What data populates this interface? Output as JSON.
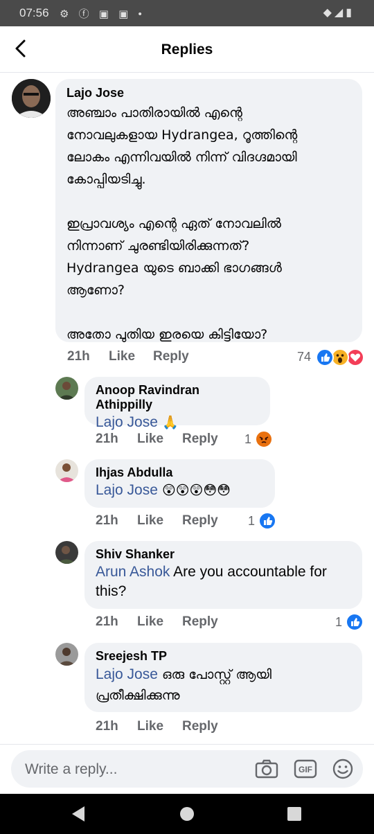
{
  "status_bar": {
    "time": "07:56",
    "left_icons": "⚙ ⓕ ▣ ▣ •",
    "right_icons": "◆◢▮"
  },
  "header": {
    "title": "Replies"
  },
  "main_comment": {
    "author": "Lajo Jose",
    "lines": [
      "അഞ്ചാം പാതിരായിൽ എന്റെ",
      "നോവലുകളായ Hydrangea, റൂത്തിന്റെ",
      "ലോകം എന്നിവയിൽ നിന്ന് വിദഗ്ദമായി",
      "കോപ്പിയടിച്ചു.",
      "",
      "ഇപ്രാവശ്യം എന്റെ ഏത് നോവലിൽ",
      "നിന്നാണ് ചുരണ്ടിയിരിക്കുന്നത്?",
      "Hydrangea യുടെ ബാക്കി ഭാഗങ്ങൾ",
      "ആണോ?",
      "",
      "അതോ പുതിയ ഇരയെ കിട്ടിയോ?"
    ],
    "time": "21h",
    "like": "Like",
    "reply": "Reply",
    "reaction_count": "74"
  },
  "replies": [
    {
      "author": "Anoop Ravindran Athippilly",
      "mention": "Lajo Jose",
      "text": " 🙏",
      "time": "21h",
      "like": "Like",
      "reply": "Reply",
      "reaction_count": "1"
    },
    {
      "author": "Ihjas Abdulla",
      "mention": "Lajo Jose",
      "text": " 😲😲😲😳😳",
      "time": "21h",
      "like": "Like",
      "reply": "Reply",
      "reaction_count": "1"
    },
    {
      "author": "Shiv Shanker",
      "mention": "Arun Ashok",
      "text_line1": " Are you accountable for",
      "text_line2": "this?",
      "time": "21h",
      "like": "Like",
      "reply": "Reply",
      "reaction_count": "1"
    },
    {
      "author": "Sreejesh TP",
      "mention": "Lajo Jose",
      "text_line1": " ഒരു പോസ്റ്റ് ആയി",
      "text_line2": "പ്രതീക്ഷിക്കുന്നു",
      "time": "21h",
      "like": "Like",
      "reply": "Reply"
    }
  ],
  "composer": {
    "placeholder": "Write a reply..."
  },
  "colors": {
    "like_blue": "#1877f2",
    "love_red": "#f33e58",
    "wow_yellow": "#f7b125",
    "angry_orange": "#e9710f",
    "mention": "#385898"
  }
}
